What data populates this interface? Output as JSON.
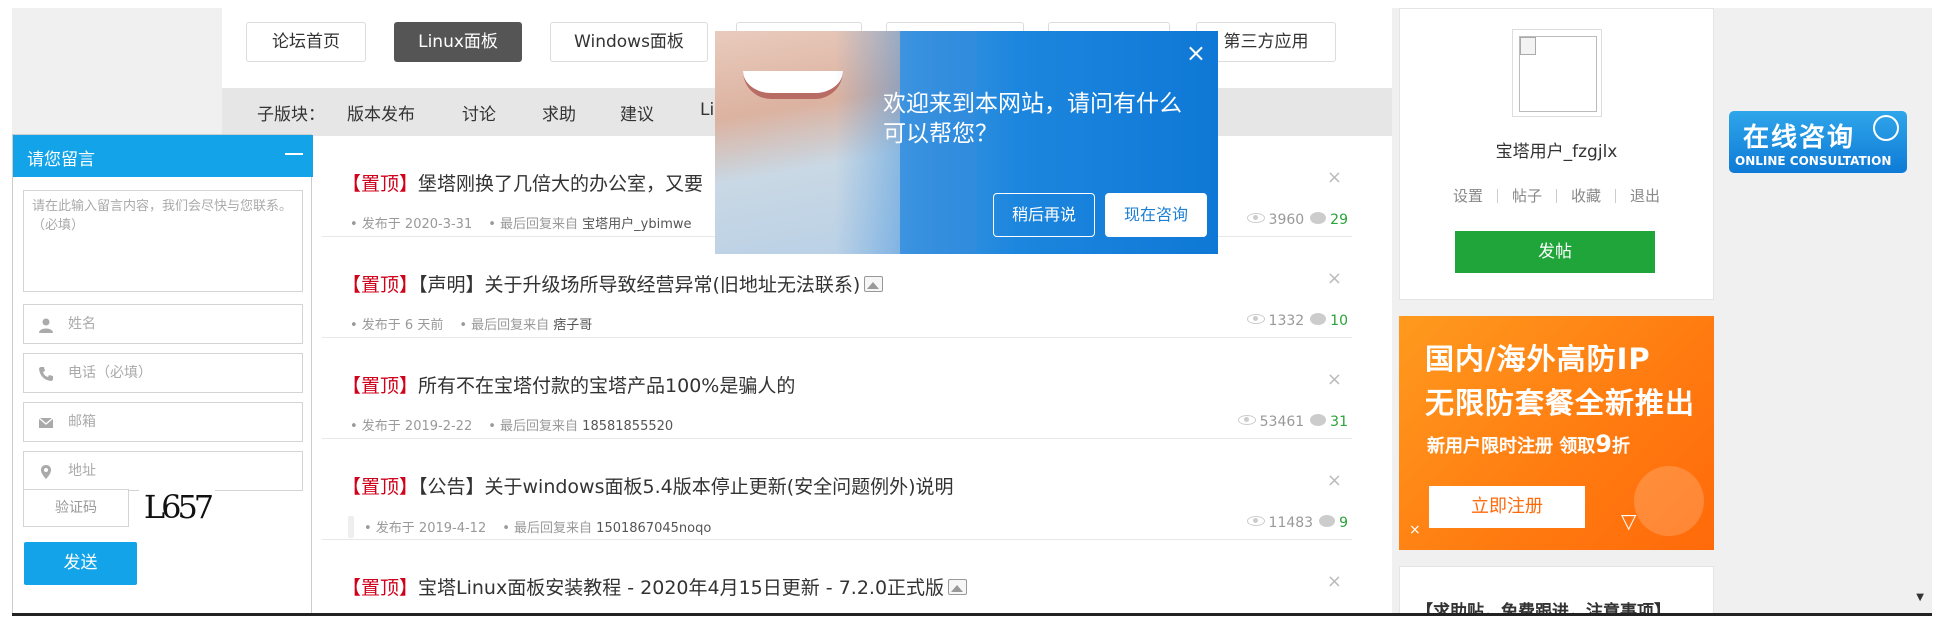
{
  "topnav": {
    "items": [
      "论坛首页",
      "Linux面板",
      "Windows面板",
      "",
      "",
      "",
      "第三方应用"
    ],
    "active_index": 1
  },
  "subnav": {
    "label": "子版块：",
    "items": [
      "版本发布",
      "讨论",
      "求助",
      "建议",
      "Lin"
    ]
  },
  "posts": [
    {
      "pin": "【置顶】",
      "title": "堡塔刚换了几倍大的办公室，又要",
      "has_image": false,
      "date": "• 发布于 2020-3-31",
      "last_reply_label": "• 最后回复来自",
      "last_reply_user": "宝塔用户_ybimwe",
      "views": "3960",
      "replies": "29"
    },
    {
      "pin": "【置顶】",
      "title": "【声明】关于升级场所导致经营异常(旧地址无法联系)",
      "has_image": true,
      "date": "• 发布于 6 天前",
      "last_reply_label": "• 最后回复来自",
      "last_reply_user": "痞子哥",
      "views": "1332",
      "replies": "10"
    },
    {
      "pin": "【置顶】",
      "title": "所有不在宝塔付款的宝塔产品100%是骗人的",
      "has_image": false,
      "date": "• 发布于 2019-2-22",
      "last_reply_label": "• 最后回复来自",
      "last_reply_user": "18581855520",
      "views": "53461",
      "replies": "31"
    },
    {
      "pin": "【置顶】",
      "title": "【公告】关于windows面板5.4版本停止更新(安全问题例外)说明",
      "has_image": false,
      "date": "• 发布于 2019-4-12",
      "last_reply_label": "• 最后回复来自",
      "last_reply_user": "1501867045noqo",
      "views": "11483",
      "replies": "9"
    },
    {
      "pin": "【置顶】",
      "title": "宝塔Linux面板安装教程 - 2020年4月15日更新 - 7.2.0正式版",
      "has_image": true,
      "date": "",
      "last_reply_label": "",
      "last_reply_user": "",
      "views": "",
      "replies": ""
    }
  ],
  "close_glyph": "×",
  "profile": {
    "username": "宝塔用户_fzgjlx",
    "links": [
      "设置",
      "帖子",
      "收藏",
      "退出"
    ],
    "post_button": "发帖"
  },
  "banner": {
    "line1": "国内/海外高防IP",
    "line2": "无限防套餐全新推出",
    "line3_prefix": "新用户限时注册 领取",
    "line3_big": "9",
    "line3_suffix": "折",
    "register": "立即注册",
    "close_glyph": "×"
  },
  "helpbox": {
    "title": "【求助贴，免费跟进，注意事项】"
  },
  "consult": {
    "title": "在线咨询",
    "subtitle": "ONLINE CONSULTATION"
  },
  "message_panel": {
    "title": "请您留言",
    "content_placeholder": "请在此输入留言内容，我们会尽快与您联系。（必填）",
    "name_placeholder": "姓名",
    "phone_placeholder": "电话（必填）",
    "email_placeholder": "邮箱",
    "address_placeholder": "地址",
    "captcha_placeholder": "验证码",
    "captcha_text": "L657",
    "send": "发送"
  },
  "popup": {
    "title": "欢迎来到本网站，请问有什么可以帮您？",
    "later": "稍后再说",
    "now": "现在咨询",
    "close_glyph": "×"
  },
  "colors": {
    "accent_blue": "#12a3e8",
    "post_green": "#20a53a",
    "pin_red": "#d0021b",
    "banner_orange": "#ff7a10"
  }
}
